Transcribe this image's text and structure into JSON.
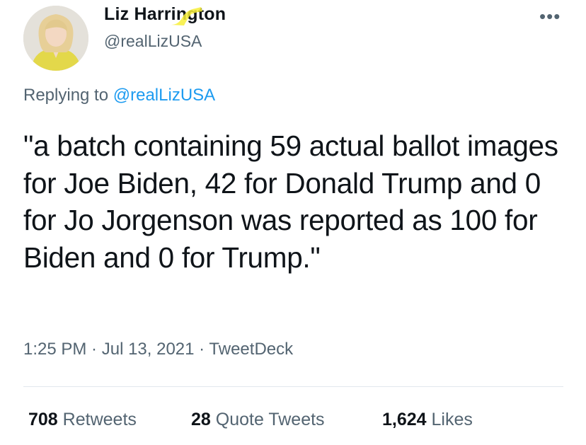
{
  "user": {
    "name": "Liz Harrington",
    "handle": "@realLizUSA"
  },
  "reply": {
    "prefix": "Replying to ",
    "to": "@realLizUSA"
  },
  "tweet": {
    "text": "\"a batch containing 59 actual ballot images for Joe Biden, 42 for Donald Trump and 0 for Jo Jorgenson was reported as 100 for Biden and 0 for Trump.\""
  },
  "meta": {
    "time": "1:25 PM",
    "date": "Jul 13, 2021",
    "source": "TweetDeck",
    "sep": " · "
  },
  "stats": {
    "retweets": {
      "count": "708",
      "label": "Retweets"
    },
    "quotes": {
      "count": "28",
      "label": "Quote Tweets"
    },
    "likes": {
      "count": "1,624",
      "label": "Likes"
    }
  },
  "icons": {
    "more": "more-horizontal-icon",
    "more_glyph": "•••"
  },
  "colors": {
    "link": "#1d9bf0",
    "secondary": "#536471",
    "text": "#0f1419",
    "highlight": "#f7ef3a"
  }
}
